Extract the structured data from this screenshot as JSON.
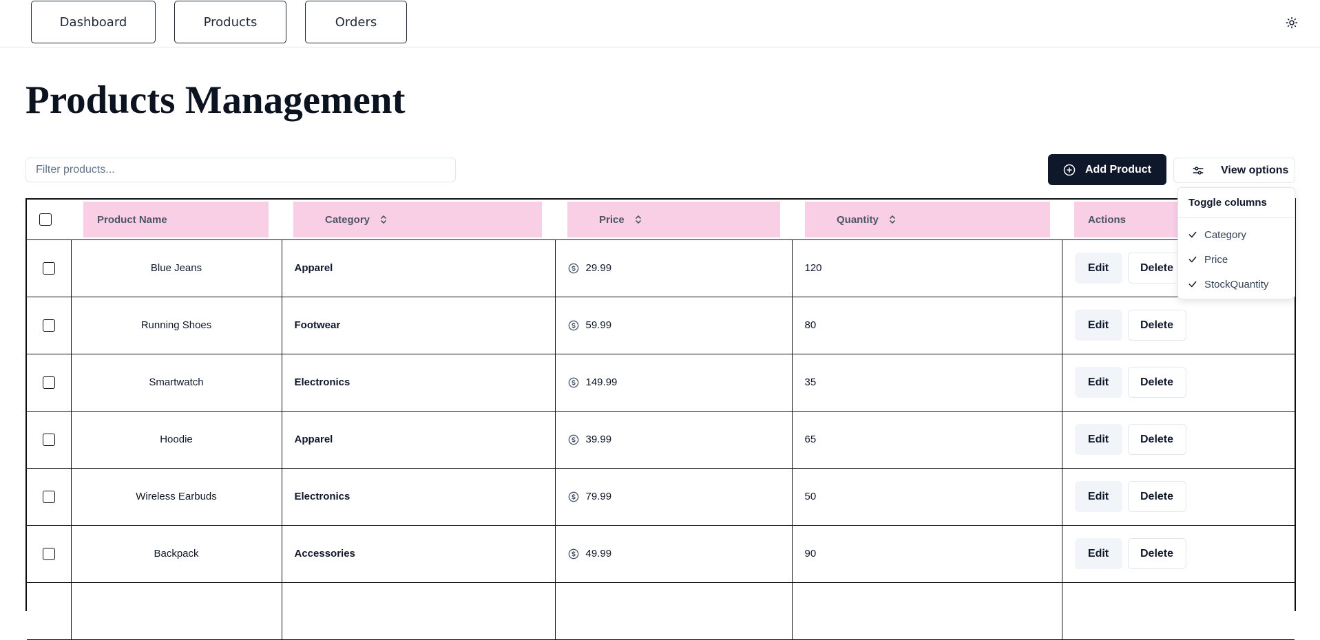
{
  "nav": {
    "items": [
      {
        "label": "Dashboard"
      },
      {
        "label": "Products"
      },
      {
        "label": "Orders"
      }
    ],
    "theme_icon": "sun-icon"
  },
  "page": {
    "title": "Products Management"
  },
  "toolbar": {
    "filter_placeholder": "Filter products...",
    "filter_value": "",
    "add_label": "Add Product",
    "add_icon": "plus-circle-icon",
    "view_label": "View options",
    "view_icon": "sliders-icon"
  },
  "table": {
    "columns": {
      "name": "Product Name",
      "category": "Category",
      "price": "Price",
      "quantity": "Quantity",
      "actions": "Actions"
    },
    "rows": [
      {
        "name": "Blue Jeans",
        "category": "Apparel",
        "price": "29.99",
        "quantity": "120"
      },
      {
        "name": "Running Shoes",
        "category": "Footwear",
        "price": "59.99",
        "quantity": "80"
      },
      {
        "name": "Smartwatch",
        "category": "Electronics",
        "price": "149.99",
        "quantity": "35"
      },
      {
        "name": "Hoodie",
        "category": "Apparel",
        "price": "39.99",
        "quantity": "65"
      },
      {
        "name": "Wireless Earbuds",
        "category": "Electronics",
        "price": "79.99",
        "quantity": "50"
      },
      {
        "name": "Backpack",
        "category": "Accessories",
        "price": "49.99",
        "quantity": "90"
      }
    ],
    "edit_label": "Edit",
    "delete_label": "Delete",
    "header_highlight_color": "#f9cfe6"
  },
  "column_menu": {
    "title": "Toggle columns",
    "items": [
      {
        "label": "Category",
        "checked": true
      },
      {
        "label": "Price",
        "checked": true
      },
      {
        "label": "StockQuantity",
        "checked": true
      }
    ]
  }
}
